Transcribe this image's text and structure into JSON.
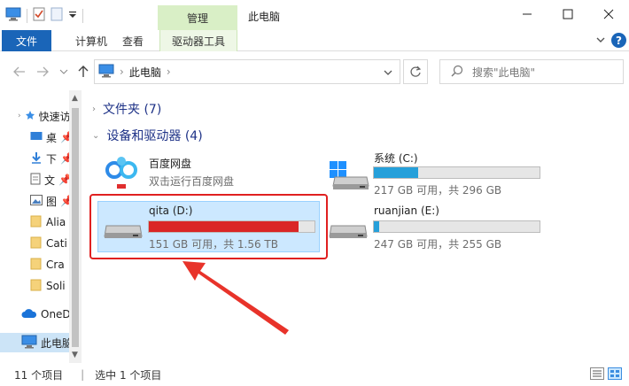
{
  "titlebar": {
    "context_tab": "管理",
    "title": "此电脑"
  },
  "ribbon": {
    "tabs": [
      "文件",
      "计算机",
      "查看",
      "驱动器工具"
    ]
  },
  "address": {
    "location": "此电脑",
    "search_placeholder": "搜索\"此电脑\""
  },
  "navpane": {
    "items": [
      "快速访",
      "桌",
      "下",
      "文",
      "图",
      "Alia",
      "Cati",
      "Cra",
      "Soli",
      "OneD",
      "此电脑"
    ]
  },
  "content": {
    "groups": [
      {
        "label": "文件夹 (7)"
      },
      {
        "label": "设备和驱动器 (4)"
      }
    ],
    "app": {
      "name": "百度网盘",
      "subtitle": "双击运行百度网盘"
    },
    "drives": [
      {
        "name": "系统 (C:)",
        "free_text": "217 GB 可用，共 296 GB",
        "used_fraction": 0.27
      },
      {
        "name": "qita (D:)",
        "free_text": "151 GB 可用，共 1.56 TB",
        "used_fraction": 0.905
      },
      {
        "name": "ruanjian (E:)",
        "free_text": "247 GB 可用，共 255 GB",
        "used_fraction": 0.03
      }
    ]
  },
  "statusbar": {
    "count": "11 个项目",
    "selected": "选中 1 个项目"
  },
  "colors": {
    "accent": "#1a65b8",
    "context_tab": "#d9efc6",
    "bar_normal": "#26a0da",
    "bar_full": "#da2626",
    "highlight": "#e02020"
  }
}
